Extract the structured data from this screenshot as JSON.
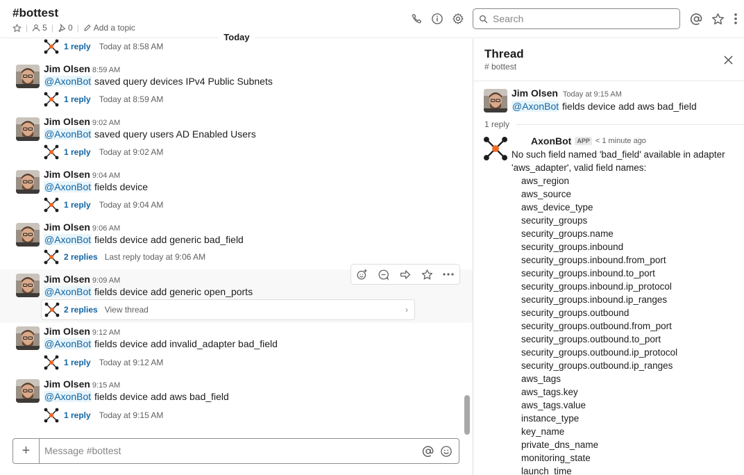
{
  "header": {
    "channel": "#bottest",
    "members": "5",
    "pins": "0",
    "add_topic": "Add a topic",
    "search_placeholder": "Search"
  },
  "divider": {
    "today": "Today"
  },
  "messages": [
    {
      "reply_count": "1 reply",
      "reply_time": "Today at 8:58 AM"
    },
    {
      "user": "Jim Olsen",
      "time": "8:59 AM",
      "mention": "@AxonBot",
      "text": "saved query devices IPv4 Public Subnets",
      "reply_count": "1 reply",
      "reply_time": "Today at 8:59 AM"
    },
    {
      "user": "Jim Olsen",
      "time": "9:02 AM",
      "mention": "@AxonBot",
      "text": "saved query users AD Enabled Users",
      "reply_count": "1 reply",
      "reply_time": "Today at 9:02 AM"
    },
    {
      "user": "Jim Olsen",
      "time": "9:04 AM",
      "mention": "@AxonBot",
      "text": "fields device",
      "reply_count": "1 reply",
      "reply_time": "Today at 9:04 AM"
    },
    {
      "user": "Jim Olsen",
      "time": "9:06 AM",
      "mention": "@AxonBot",
      "text": "fields device add generic bad_field",
      "reply_count": "2 replies",
      "reply_time": "Last reply today at 9:06 AM"
    },
    {
      "user": "Jim Olsen",
      "time": "9:09 AM",
      "mention": "@AxonBot",
      "text": "fields device add generic open_ports",
      "reply_count": "2 replies",
      "reply_time": "View thread"
    },
    {
      "user": "Jim Olsen",
      "time": "9:12 AM",
      "mention": "@AxonBot",
      "text": "fields device add invalid_adapter bad_field",
      "reply_count": "1 reply",
      "reply_time": "Today at 9:12 AM"
    },
    {
      "user": "Jim Olsen",
      "time": "9:15 AM",
      "mention": "@AxonBot",
      "text": "fields device add aws bad_field",
      "reply_count": "1 reply",
      "reply_time": "Today at 9:15 AM"
    }
  ],
  "composer": {
    "placeholder": "Message #bottest"
  },
  "thread": {
    "title": "Thread",
    "channel": "# bottest",
    "parent": {
      "user": "Jim Olsen",
      "time": "Today at 9:15 AM",
      "mention": "@AxonBot",
      "text": "fields device add aws bad_field"
    },
    "reply_count": "1 reply",
    "bot": {
      "name": "AxonBot",
      "badge": "APP",
      "ago": "< 1 minute ago",
      "text": "No such field named 'bad_field' available in adapter 'aws_adapter', valid field names:",
      "fields": [
        "aws_region",
        "aws_source",
        "aws_device_type",
        "security_groups",
        "security_groups.name",
        "security_groups.inbound",
        "security_groups.inbound.from_port",
        "security_groups.inbound.to_port",
        "security_groups.inbound.ip_protocol",
        "security_groups.inbound.ip_ranges",
        "security_groups.outbound",
        "security_groups.outbound.from_port",
        "security_groups.outbound.to_port",
        "security_groups.outbound.ip_protocol",
        "security_groups.outbound.ip_ranges",
        "aws_tags",
        "aws_tags.key",
        "aws_tags.value",
        "instance_type",
        "key_name",
        "private_dns_name",
        "monitoring_state",
        "launch_time"
      ]
    }
  },
  "colors": {
    "link": "#1264a3",
    "mention_bg": "#e8f5fa",
    "bot_dot": "#f26822"
  }
}
